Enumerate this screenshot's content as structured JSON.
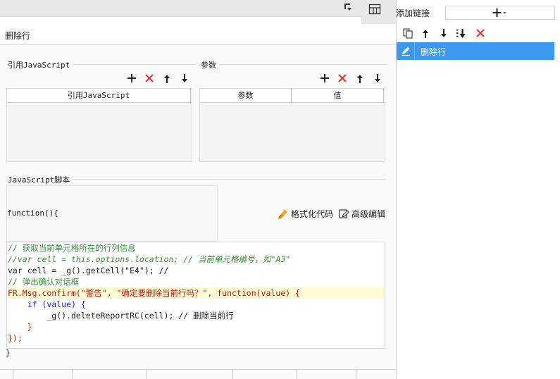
{
  "panel_title": "删除行",
  "ref_js": {
    "section_label": "引用JavaScript",
    "column_header": "引用JavaScript"
  },
  "params": {
    "section_label": "参数",
    "columns": [
      "参数",
      "值"
    ]
  },
  "script": {
    "section_label": "JavaScript脚本",
    "function_open": "function(){",
    "function_close": "}",
    "format_label": "格式化代码",
    "advanced_label": "高级编辑"
  },
  "code_lines": [
    "// 获取当前单元格所在的行列信息",
    "//var cell = this.options.location; // 当前单元格编号，如\"A3\"",
    "var cell = _g().getCell(\"E4\"); //",
    "// 弹出确认对话框",
    "FR.Msg.confirm(\"警告\", \"确定要删除当前行吗？\", function(value) {",
    "    if (value) {",
    "        _g().deleteReportRC(cell); // 删除当前行",
    "    }",
    "});"
  ],
  "right_panel": {
    "add_link_label": "添加链接",
    "add_button": "+",
    "links": [
      {
        "label": "删除行",
        "selected": true
      }
    ]
  },
  "colors": {
    "selected": "#3b9aef",
    "delete": "#e53935",
    "highlight_line": "#fefcd4"
  }
}
